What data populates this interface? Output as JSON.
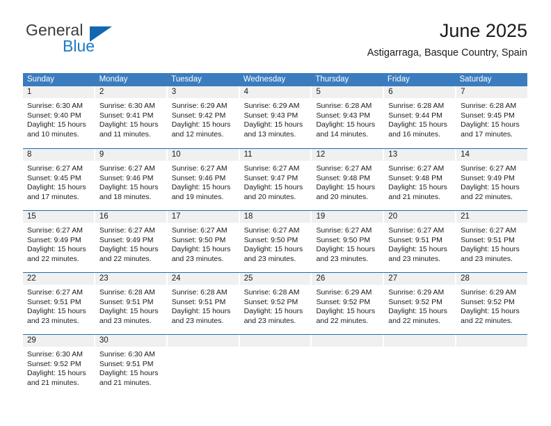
{
  "brand": {
    "name_part1": "General",
    "name_part2": "Blue",
    "triangle_icon": "triangle-icon",
    "accent_color": "#1267b2",
    "blue_text_color": "#1b79c6"
  },
  "header": {
    "title": "June 2025",
    "subtitle": "Astigarraga, Basque Country, Spain"
  },
  "calendar": {
    "header_bg_color": "#3a7cbe",
    "day_band_color": "#f0f0f0",
    "row_divider_color": "#1f6cb0",
    "weekdays": [
      "Sunday",
      "Monday",
      "Tuesday",
      "Wednesday",
      "Thursday",
      "Friday",
      "Saturday"
    ],
    "weeks": [
      [
        {
          "day": "1",
          "sunrise": "Sunrise: 6:30 AM",
          "sunset": "Sunset: 9:40 PM",
          "daylight": "Daylight: 15 hours and 10 minutes."
        },
        {
          "day": "2",
          "sunrise": "Sunrise: 6:30 AM",
          "sunset": "Sunset: 9:41 PM",
          "daylight": "Daylight: 15 hours and 11 minutes."
        },
        {
          "day": "3",
          "sunrise": "Sunrise: 6:29 AM",
          "sunset": "Sunset: 9:42 PM",
          "daylight": "Daylight: 15 hours and 12 minutes."
        },
        {
          "day": "4",
          "sunrise": "Sunrise: 6:29 AM",
          "sunset": "Sunset: 9:43 PM",
          "daylight": "Daylight: 15 hours and 13 minutes."
        },
        {
          "day": "5",
          "sunrise": "Sunrise: 6:28 AM",
          "sunset": "Sunset: 9:43 PM",
          "daylight": "Daylight: 15 hours and 14 minutes."
        },
        {
          "day": "6",
          "sunrise": "Sunrise: 6:28 AM",
          "sunset": "Sunset: 9:44 PM",
          "daylight": "Daylight: 15 hours and 16 minutes."
        },
        {
          "day": "7",
          "sunrise": "Sunrise: 6:28 AM",
          "sunset": "Sunset: 9:45 PM",
          "daylight": "Daylight: 15 hours and 17 minutes."
        }
      ],
      [
        {
          "day": "8",
          "sunrise": "Sunrise: 6:27 AM",
          "sunset": "Sunset: 9:45 PM",
          "daylight": "Daylight: 15 hours and 17 minutes."
        },
        {
          "day": "9",
          "sunrise": "Sunrise: 6:27 AM",
          "sunset": "Sunset: 9:46 PM",
          "daylight": "Daylight: 15 hours and 18 minutes."
        },
        {
          "day": "10",
          "sunrise": "Sunrise: 6:27 AM",
          "sunset": "Sunset: 9:46 PM",
          "daylight": "Daylight: 15 hours and 19 minutes."
        },
        {
          "day": "11",
          "sunrise": "Sunrise: 6:27 AM",
          "sunset": "Sunset: 9:47 PM",
          "daylight": "Daylight: 15 hours and 20 minutes."
        },
        {
          "day": "12",
          "sunrise": "Sunrise: 6:27 AM",
          "sunset": "Sunset: 9:48 PM",
          "daylight": "Daylight: 15 hours and 20 minutes."
        },
        {
          "day": "13",
          "sunrise": "Sunrise: 6:27 AM",
          "sunset": "Sunset: 9:48 PM",
          "daylight": "Daylight: 15 hours and 21 minutes."
        },
        {
          "day": "14",
          "sunrise": "Sunrise: 6:27 AM",
          "sunset": "Sunset: 9:49 PM",
          "daylight": "Daylight: 15 hours and 22 minutes."
        }
      ],
      [
        {
          "day": "15",
          "sunrise": "Sunrise: 6:27 AM",
          "sunset": "Sunset: 9:49 PM",
          "daylight": "Daylight: 15 hours and 22 minutes."
        },
        {
          "day": "16",
          "sunrise": "Sunrise: 6:27 AM",
          "sunset": "Sunset: 9:49 PM",
          "daylight": "Daylight: 15 hours and 22 minutes."
        },
        {
          "day": "17",
          "sunrise": "Sunrise: 6:27 AM",
          "sunset": "Sunset: 9:50 PM",
          "daylight": "Daylight: 15 hours and 23 minutes."
        },
        {
          "day": "18",
          "sunrise": "Sunrise: 6:27 AM",
          "sunset": "Sunset: 9:50 PM",
          "daylight": "Daylight: 15 hours and 23 minutes."
        },
        {
          "day": "19",
          "sunrise": "Sunrise: 6:27 AM",
          "sunset": "Sunset: 9:50 PM",
          "daylight": "Daylight: 15 hours and 23 minutes."
        },
        {
          "day": "20",
          "sunrise": "Sunrise: 6:27 AM",
          "sunset": "Sunset: 9:51 PM",
          "daylight": "Daylight: 15 hours and 23 minutes."
        },
        {
          "day": "21",
          "sunrise": "Sunrise: 6:27 AM",
          "sunset": "Sunset: 9:51 PM",
          "daylight": "Daylight: 15 hours and 23 minutes."
        }
      ],
      [
        {
          "day": "22",
          "sunrise": "Sunrise: 6:27 AM",
          "sunset": "Sunset: 9:51 PM",
          "daylight": "Daylight: 15 hours and 23 minutes."
        },
        {
          "day": "23",
          "sunrise": "Sunrise: 6:28 AM",
          "sunset": "Sunset: 9:51 PM",
          "daylight": "Daylight: 15 hours and 23 minutes."
        },
        {
          "day": "24",
          "sunrise": "Sunrise: 6:28 AM",
          "sunset": "Sunset: 9:51 PM",
          "daylight": "Daylight: 15 hours and 23 minutes."
        },
        {
          "day": "25",
          "sunrise": "Sunrise: 6:28 AM",
          "sunset": "Sunset: 9:52 PM",
          "daylight": "Daylight: 15 hours and 23 minutes."
        },
        {
          "day": "26",
          "sunrise": "Sunrise: 6:29 AM",
          "sunset": "Sunset: 9:52 PM",
          "daylight": "Daylight: 15 hours and 22 minutes."
        },
        {
          "day": "27",
          "sunrise": "Sunrise: 6:29 AM",
          "sunset": "Sunset: 9:52 PM",
          "daylight": "Daylight: 15 hours and 22 minutes."
        },
        {
          "day": "28",
          "sunrise": "Sunrise: 6:29 AM",
          "sunset": "Sunset: 9:52 PM",
          "daylight": "Daylight: 15 hours and 22 minutes."
        }
      ],
      [
        {
          "day": "29",
          "sunrise": "Sunrise: 6:30 AM",
          "sunset": "Sunset: 9:52 PM",
          "daylight": "Daylight: 15 hours and 21 minutes."
        },
        {
          "day": "30",
          "sunrise": "Sunrise: 6:30 AM",
          "sunset": "Sunset: 9:51 PM",
          "daylight": "Daylight: 15 hours and 21 minutes."
        },
        {
          "day": "",
          "sunrise": "",
          "sunset": "",
          "daylight": ""
        },
        {
          "day": "",
          "sunrise": "",
          "sunset": "",
          "daylight": ""
        },
        {
          "day": "",
          "sunrise": "",
          "sunset": "",
          "daylight": ""
        },
        {
          "day": "",
          "sunrise": "",
          "sunset": "",
          "daylight": ""
        },
        {
          "day": "",
          "sunrise": "",
          "sunset": "",
          "daylight": ""
        }
      ]
    ]
  }
}
